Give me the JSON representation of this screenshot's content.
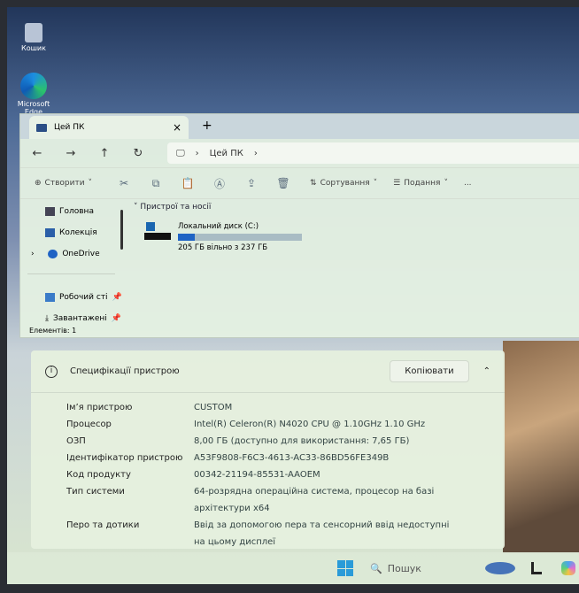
{
  "desktop": {
    "icons": [
      {
        "label": "Кошик",
        "icon": "recycle-bin-icon"
      },
      {
        "label": "Microsoft Edge",
        "icon": "edge-icon"
      }
    ]
  },
  "explorer": {
    "tab_title": "Цей ПК",
    "address": {
      "crumb": "Цей ПК"
    },
    "toolbar": {
      "create": "Створити",
      "sort": "Сортування",
      "view": "Подання",
      "more": "..."
    },
    "sidebar": [
      {
        "label": "Головна"
      },
      {
        "label": "Колекція"
      },
      {
        "label": "OneDrive"
      },
      {
        "label": "Робочий сті"
      },
      {
        "label": "Завантажені"
      }
    ],
    "section": "Пристрої та носії",
    "drive": {
      "name": "Локальний диск (C:)",
      "usage": "205 ГБ вільно з 237 ГБ",
      "used_fraction": 0.135,
      "bar_color": "#1f63c4"
    },
    "status": "Елементів: 1"
  },
  "specs": {
    "title": "Специфікації пристрою",
    "copy_label": "Копіювати",
    "rows": [
      {
        "k": "Ім’я пристрою",
        "v": "CUSTOM"
      },
      {
        "k": "Процесор",
        "v": "Intel(R) Celeron(R) N4020 CPU @ 1.10GHz   1.10 GHz"
      },
      {
        "k": "ОЗП",
        "v": "8,00 ГБ (доступно для використання: 7,65 ГБ)"
      },
      {
        "k": "Ідентифікатор пристрою",
        "v": "A53F9808-F6C3-4613-AC33-86BD56FE349B"
      },
      {
        "k": "Код продукту",
        "v": "00342-21194-85531-AAOEM"
      },
      {
        "k": "Тип системи",
        "v": "64-розрядна операційна система, процесор на базі архітектури x64"
      },
      {
        "k": "Перо та дотики",
        "v": "Ввід за допомогою пера та сенсорний ввід недоступні на цьому дисплеї"
      }
    ]
  },
  "taskbar": {
    "search_placeholder": "Пошук"
  }
}
